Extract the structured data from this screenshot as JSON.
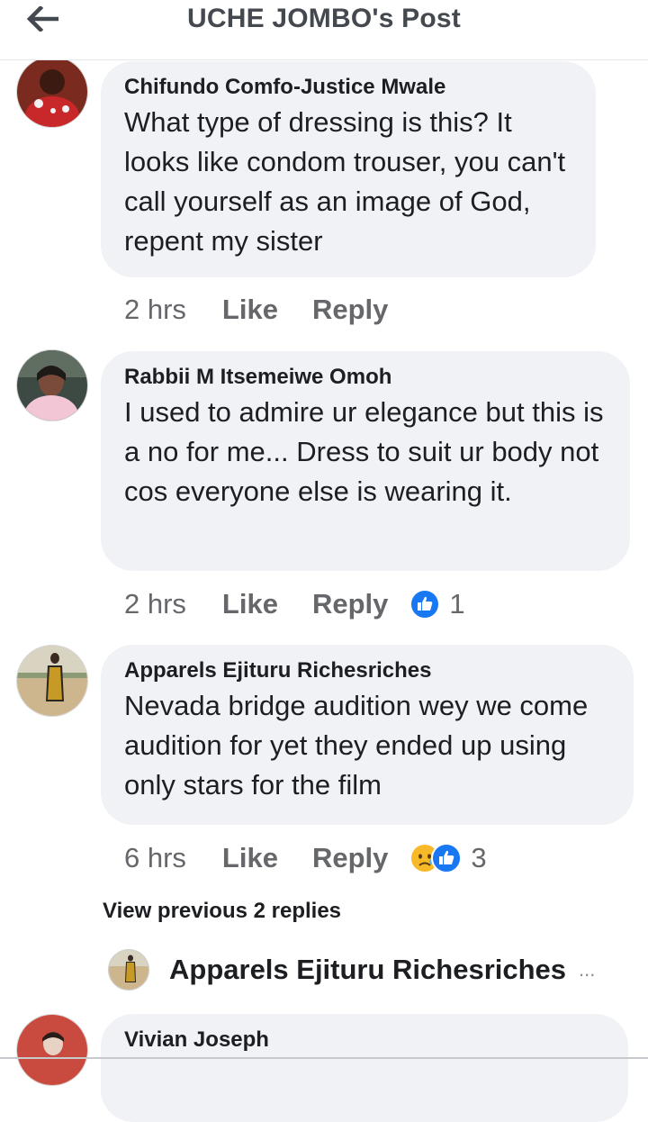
{
  "header": {
    "title": "UCHE JOMBO's Post",
    "back_icon": "arrow-left-icon"
  },
  "comments": [
    {
      "author": "Chifundo Comfo-Justice Mwale",
      "text": "What type of dressing is this? It looks like condom trouser, you can't call yourself as an image of God, repent my sister",
      "time": "2 hrs",
      "like_label": "Like",
      "reply_label": "Reply"
    },
    {
      "author": "Rabbii M Itsemeiwe Omoh",
      "text": "I used to admire ur elegance but this is a no for me... Dress to suit ur body not cos everyone else is wearing it.",
      "time": "2 hrs",
      "like_label": "Like",
      "reply_label": "Reply",
      "reactions": {
        "icons": [
          "like-icon"
        ],
        "count": "1"
      }
    },
    {
      "author": "Apparels Ejituru Richesriches",
      "text": "Nevada bridge audition wey we come audition for yet they ended up using only stars for the film",
      "time": "6 hrs",
      "like_label": "Like",
      "reply_label": "Reply",
      "reactions": {
        "icons": [
          "sad-face-icon",
          "like-icon"
        ],
        "count": "3"
      }
    }
  ],
  "view_previous": "View previous 2 replies",
  "reply_preview": {
    "author": "Apparels Ejituru Richesriches",
    "more": "..."
  },
  "next_comment": {
    "author": "Vivian Joseph"
  },
  "colors": {
    "bubble": "#f0f2f5",
    "secondary_text": "#65676b",
    "like_blue": "#1877f2",
    "sad_yellow": "#f7b928"
  }
}
